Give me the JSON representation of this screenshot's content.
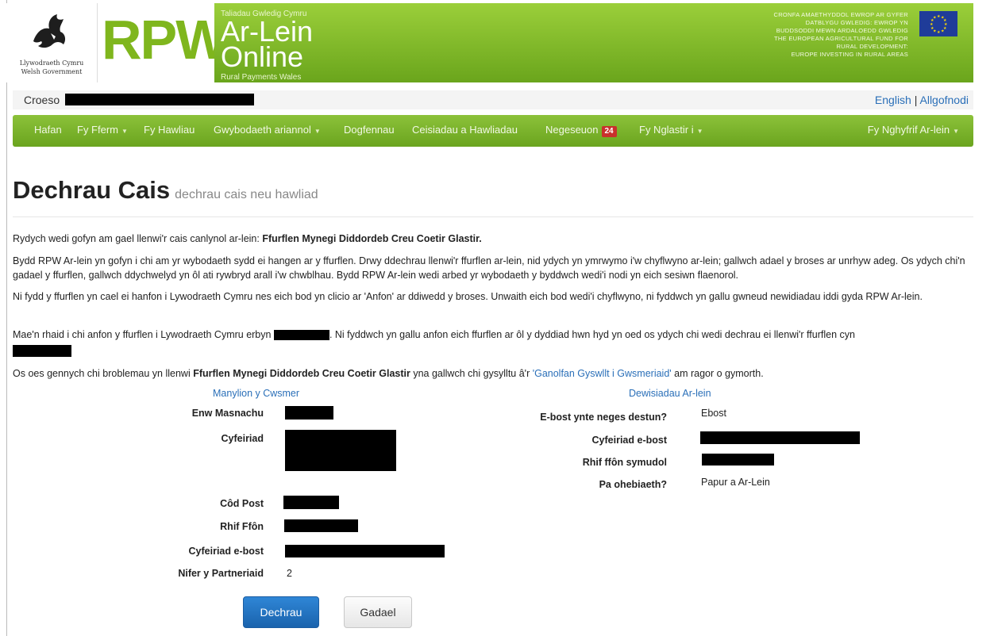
{
  "header": {
    "wg_welsh": "Llywodraeth Cymru",
    "wg_english": "Welsh Government",
    "rpw": "RPW",
    "taliadau": "Taliadau Gwledig Cymru",
    "arlein": "Ar-Lein",
    "online": "Online",
    "rural_payments": "Rural Payments Wales",
    "eu_line1": "CRONFA AMAETHYDDOL EWROP AR GYFER",
    "eu_line2": "DATBLYGU GWLEDIG: EWROP YN",
    "eu_line3": "BUDDSODDI MEWN ARDALOEDD GWLEDIG",
    "eu_line4": "THE EUROPEAN AGRICULTURAL FUND FOR",
    "eu_line5": "RURAL DEVELOPMENT:",
    "eu_line6": "EUROPE INVESTING IN RURAL AREAS"
  },
  "welcome": {
    "croeso": "Croeso",
    "english": "English",
    "sep": "|",
    "logout": "Allgofnodi"
  },
  "nav": {
    "hafan": "Hafan",
    "fferm": "Fy Fferm",
    "hawliau": "Fy Hawliau",
    "gwybodaeth": "Gwybodaeth ariannol",
    "dogfennau": "Dogfennau",
    "ceisiadau": "Ceisiadau a Hawliadau",
    "negeseuon": "Negeseuon",
    "negeseuon_count": "24",
    "nglastir": "Fy Nglastir i",
    "nghyfrif": "Fy Nghyfrif Ar-lein"
  },
  "page": {
    "title": "Dechrau Cais",
    "subtitle": "dechrau cais neu hawliad"
  },
  "paragraphs": {
    "p1_text": "Rydych wedi gofyn am gael llenwi'r cais canlynol ar-lein: ",
    "p1_bold": "Ffurflen Mynegi Diddordeb Creu Coetir Glastir.",
    "p2": "Bydd RPW Ar-lein yn gofyn i chi am yr wybodaeth sydd ei hangen ar y ffurflen. Drwy ddechrau llenwi'r ffurflen ar-lein, nid ydych yn ymrwymo i'w chyflwyno ar-lein; gallwch adael y broses ar unrhyw adeg. Os ydych chi'n gadael y ffurflen, gallwch ddychwelyd yn ôl ati rywbryd arall i'w chwblhau. Bydd RPW Ar-lein wedi arbed yr wybodaeth y byddwch wedi'i nodi yn eich sesiwn flaenorol.",
    "p3": "Ni fydd y ffurflen yn cael ei hanfon i Lywodraeth Cymru nes eich bod yn clicio ar 'Anfon' ar ddiwedd y broses. Unwaith eich bod wedi'i chyflwyno, ni fyddwch yn gallu gwneud newidiadau iddi gyda RPW Ar-lein.",
    "p4_a": "Mae'n rhaid i chi anfon y ffurflen i Lywodraeth Cymru erbyn ",
    "p4_b": ". Ni fyddwch yn gallu anfon eich ffurflen ar ôl y dyddiad hwn hyd yn oed os ydych chi wedi dechrau ei llenwi'r ffurflen cyn",
    "p5_a": "Os oes gennych chi broblemau yn llenwi ",
    "p5_bold": "Ffurflen Mynegi Diddordeb Creu Coetir Glastir",
    "p5_b": " yna gallwch chi gysylltu â'r ",
    "p5_link": "'Ganolfan Gyswllt i Gwsmeriaid'",
    "p5_c": " am ragor o gymorth."
  },
  "customer": {
    "title": "Manylion y Cwsmer",
    "trading_name": "Enw Masnachu",
    "address": "Cyfeiriad",
    "postcode": "Côd Post",
    "phone": "Rhif Ffôn",
    "email": "Cyfeiriad e-bost",
    "partners": "Nifer y Partneriaid",
    "partners_value": "2"
  },
  "online_prefs": {
    "title": "Dewisiadau Ar-lein",
    "email_or_text": "E-bost ynte neges destun?",
    "email_or_text_value": "Ebost",
    "email_address": "Cyfeiriad e-bost",
    "mobile": "Rhif ffôn symudol",
    "correspondence": "Pa ohebiaeth?",
    "correspondence_value": "Papur a Ar-Lein"
  },
  "buttons": {
    "start": "Dechrau",
    "leave": "Gadael"
  },
  "colors": {
    "brand_green": "#7fb61d",
    "link_blue": "#2a6fb8",
    "primary_button": "#1a63ad",
    "badge_red": "#c9302c"
  }
}
